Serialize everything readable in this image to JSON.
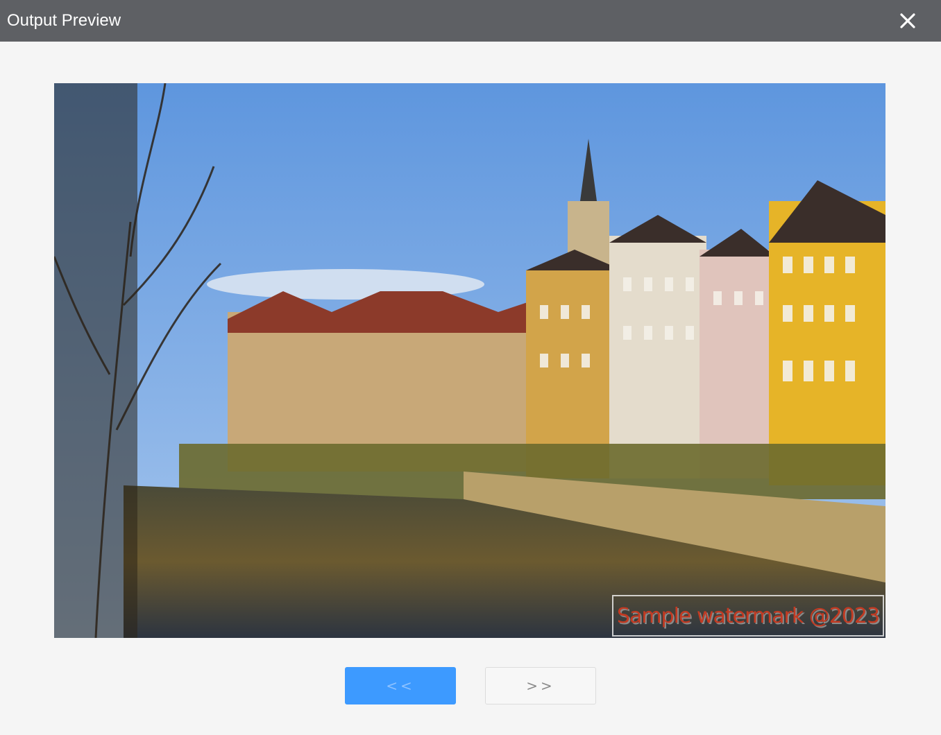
{
  "window": {
    "title": "Output Preview",
    "close_icon": "close-icon"
  },
  "preview": {
    "image_description_icon": "landscape-photo",
    "watermark_text": "Sample watermark @2023"
  },
  "navigation": {
    "prev_label": "<<",
    "next_label": ">>"
  },
  "colors": {
    "titlebar": "#5e6064",
    "prev_button": "#3d9aff",
    "watermark": "#c23a22"
  }
}
